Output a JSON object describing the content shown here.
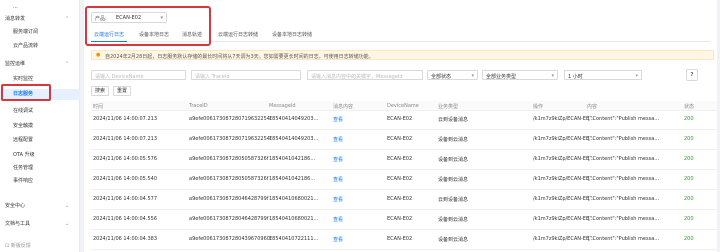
{
  "sidebar": {
    "items": [
      {
        "label": "...",
        "sub": true
      },
      {
        "label": "消息转发",
        "sub": false,
        "chev": "^"
      },
      {
        "label": "服务端订阅",
        "sub": true
      },
      {
        "label": "云产品流转",
        "sub": true
      },
      {
        "label": "监控运维",
        "sub": false,
        "chev": "^"
      },
      {
        "label": "实时监控",
        "sub": true
      },
      {
        "label": "日志服务",
        "sub": true,
        "active": true
      },
      {
        "label": "在线调试",
        "sub": true
      },
      {
        "label": "安全触摸",
        "sub": true
      },
      {
        "label": "远程配置",
        "sub": true
      },
      {
        "label": "OTA 升级",
        "sub": true
      },
      {
        "label": "任务管理",
        "sub": true
      },
      {
        "label": "事件响应",
        "sub": true
      },
      {
        "label": "安全中心",
        "sub": false,
        "chev": "v"
      },
      {
        "label": "文档与工具",
        "sub": false,
        "chev": "v"
      }
    ],
    "footer": "新版反馈"
  },
  "product": {
    "label": "产品:",
    "value": "ECAN-E02"
  },
  "tabs": [
    {
      "label": "云端运行日志",
      "active": true
    },
    {
      "label": "设备本地日志"
    },
    {
      "label": "消息轨迹"
    },
    {
      "label": "云端运行日志转储"
    },
    {
      "label": "设备本地日志转储"
    }
  ],
  "notice": "自2024年2月28日起，日志服务默认存储的最长时间将从7天调为3天。您如需要更长时间的日志，可使用日志转储功能。",
  "filters": {
    "device_ph": "请输入 DeviceName",
    "trace_ph": "请输入 TraceId",
    "msg_ph": "请输入消息内容中的关键字，MessageId",
    "all_status": "全部状态",
    "all_biz": "全部业务类型",
    "time": "1 小时",
    "search": "搜索",
    "reset": "重置",
    "help": "?"
  },
  "table": {
    "headers": [
      "时间",
      "TraceID",
      "MessageId",
      "消息内容",
      "DeviceName",
      "业务类型",
      "操作",
      "内容",
      "状态"
    ],
    "rows": [
      [
        "2024/11/06 14:00:07.213",
        "a9efe006173087280719632254f",
        "18540414049203...",
        "查看",
        "ECAN-E02",
        "云到设备消息",
        "/k1m7z9kiZp/ECAN-EE...",
        "{\"Content\":\"Publish messa...",
        "200"
      ],
      [
        "2024/11/06 14:00:07.213",
        "a9efe006173087280719632254f",
        "18540414049203...",
        "查看",
        "ECAN-E02",
        "设备到云消息",
        "/k1m7z9kiZp/ECAN-EE...",
        "{\"Content\":\"Publish messa...",
        "200"
      ],
      [
        "2024/11/06 14:00:05.576",
        "a9efe00617308728050587326f",
        "1854041042186...",
        "查看",
        "ECAN-E02",
        "设备到云消息",
        "/k1m7z9kiZp/ECAN-EE...",
        "{\"Content\":\"Publish messa...",
        "200"
      ],
      [
        "2024/11/06 14:00:05.540",
        "a9efe00617308728050587326f",
        "1854041042186...",
        "查看",
        "ECAN-E02",
        "设备到云消息",
        "/k1m7z9kiZp/ECAN-EE...",
        "{\"Content\":\"Publish messa...",
        "200"
      ],
      [
        "2024/11/06 14:00:04.577",
        "a9efe00617308728046428799f",
        "18540410680021...",
        "查看",
        "ECAN-E02",
        "云到设备消息",
        "/k1m7z9kiZp/ECAN-EE...",
        "{\"Content\":\"Publish messa...",
        "200"
      ],
      [
        "2024/11/06 14:00:04.556",
        "a9efe00617308728046428799f",
        "18540410680021...",
        "查看",
        "ECAN-E02",
        "设备到云消息",
        "/k1m7z9kiZp/ECAN-EE...",
        "{\"Content\":\"Publish messa...",
        "200"
      ],
      [
        "2024/11/06 14:00:04.383",
        "a9efe006173087280439670960f",
        "18540410722111...",
        "查看",
        "ECAN-E02",
        "设备到云消息",
        "/k1m7z9kiZp/ECAN-EE...",
        "{\"Content\":\"Publish messa...",
        "200"
      ]
    ]
  },
  "colors": {
    "accent": "#1677ff",
    "highlight": "#d9363e",
    "success": "#2e9e2e"
  }
}
